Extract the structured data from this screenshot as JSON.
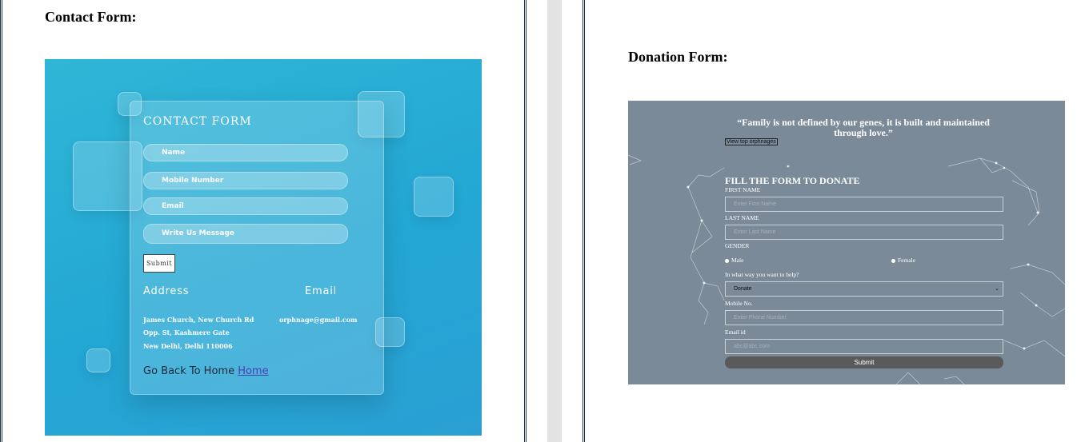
{
  "contact_section": {
    "heading": "Contact Form:",
    "form": {
      "title": "CONTACT FORM",
      "fields": [
        "Name",
        "Mobile Number",
        "Email",
        "Write Us Message"
      ],
      "submit_label": "Submit",
      "address_title": "Address",
      "email_title": "Email",
      "address_lines": [
        "James Church, New Church Rd",
        "Opp. St, Kashmere Gate",
        "New Delhi, Delhi 110006"
      ],
      "email_value": "orphnage@gmail.com",
      "go_back_text": "Go Back To Home",
      "home_link": "Home"
    }
  },
  "donation_section": {
    "heading": "Donation Form:",
    "form": {
      "quote": "“Family is not defined by our genes, it is built and maintained through love.”",
      "view_link": "View top orphnages",
      "title": "FILL THE FORM TO DONATE",
      "first_name_label": "FIRST NAME",
      "first_name_placeholder": "Enter First Name",
      "last_name_label": "LAST NAME",
      "last_name_placeholder": "Enter Last Name",
      "gender_label": "GENDER",
      "gender_options": [
        "Male",
        "Female"
      ],
      "help_label": "In what way you want to help?",
      "help_selected": "Donate",
      "mobile_label": "Mobile No.",
      "mobile_placeholder": "Enter Phone Number",
      "email_label": "Email id",
      "email_placeholder": "abc@abc.com",
      "submit_label": "Submit"
    }
  },
  "colors": {
    "contact_bg": "#23a7d4",
    "donation_bg": "#7a8a98",
    "page_border": "#1f2f5e",
    "link": "#4a3fb0"
  }
}
